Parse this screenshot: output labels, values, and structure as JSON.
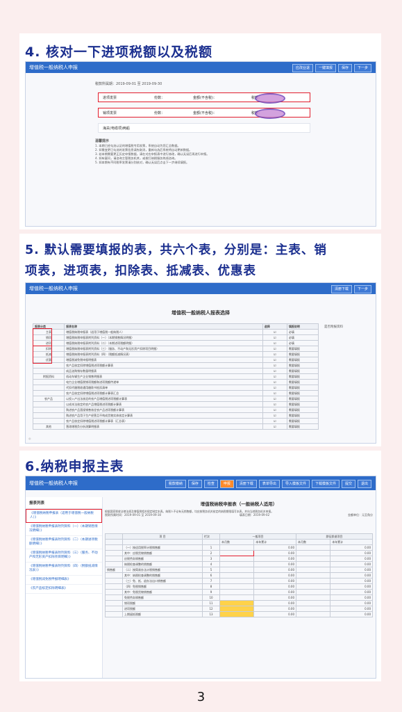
{
  "sections": [
    {
      "heading": "4. 核对一下进项税额以及税额",
      "app_title": "增值税一般纳税人申报",
      "toolbar": [
        "应改业退",
        "一键填报",
        "保存",
        "下一步"
      ],
      "period": "税款所属期：2019-09-01 至 2019-09-30",
      "rows": [
        {
          "label": "进项发票",
          "count_label": "份数：",
          "amount_label": "金额(不含税)：",
          "tax_label": "税额："
        },
        {
          "label": "销项发票",
          "count_label": "份数：",
          "amount_label": "金额(不含税)：",
          "tax_label": "税额："
        }
      ],
      "collapsed_row": "海关(电缆项)两船",
      "notes_title": "温馨提示",
      "notes": [
        "1. 本期已经勾选认证的增值税专用发票，系统自动为您汇总数据。",
        "2. 如需变更已勾选的发票信息请先取消，重新勾选后系统将自动更新数据。",
        "3. 若本期需要更正历史申报数据，请在对应申报表中进行修改，确认无误后再进行申报。",
        "4. 如有疑问，请咨询主管税务机关，或拨打纳税服务热线咨询。",
        "5. 如本期有不同税率发票请分别核对，确认无误后点击下一步继续填报。"
      ]
    },
    {
      "heading_line1": "5. 默认需要填报的表，共六个表，分别是：主表、销",
      "heading_line2": "项表，进项表，扣除表、抵减表、优惠表",
      "app_title": "增值税一般纳税人申报",
      "toolbar": [
        "清册下载",
        "下一步"
      ],
      "table_title": "增值税一般纳税人报表选择",
      "side_note": "是否附报资料",
      "headers": [
        "报表分类",
        "报表名称",
        "选择",
        "填报说明"
      ],
      "groups": [
        {
          "category": "主表",
          "name": "增值税纳税申报表（适用于增值税一般纳税人）",
          "state": "必填"
        },
        {
          "category": "销项",
          "name": "增值税纳税申报表附列资料（一）（本期销售情况明细）",
          "state": "必填"
        },
        {
          "category": "进项",
          "name": "增值税纳税申报表附列资料（二）（本期进项税额明细）",
          "state": "必填"
        },
        {
          "category": "扣除",
          "name": "增值税纳税申报表附列资料（三）（服务、不动产和无形资产扣除项目明细）",
          "state": "需要填报"
        },
        {
          "category": "抵减",
          "name": "增值税纳税申报表附列资料（四）（税额抵减情况表）",
          "state": "需要填报"
        },
        {
          "category": "优惠",
          "name": "增值税减免税申报明细表",
          "state": "需要填报"
        },
        {
          "category": "",
          "name": "农产品核定扣除增值税进项税额计算表",
          "state": "需要填报"
        },
        {
          "category": "",
          "name": "成品油购销存数量明细表",
          "state": "需要填报"
        },
        {
          "category": "附报资料",
          "name": "机动车辆生产企业销售明细表",
          "state": "需要填报"
        },
        {
          "category": "",
          "name": "电力企业增值税销项税额和进项税额传递单",
          "state": "需要填报"
        },
        {
          "category": "",
          "name": "代扣代缴税收通用缴款书抵扣清单",
          "state": "需要填报"
        },
        {
          "category": "",
          "name": "农产品核定扣除增值税进项税额计算表汇总",
          "state": "需要填报"
        },
        {
          "category": "农产品",
          "name": "以投入产出法核定的农产品增值税进项税额计算表",
          "state": "需要填报"
        },
        {
          "category": "",
          "name": "以成本法核定的农产品增值税进项税额计算表",
          "state": "需要填报"
        },
        {
          "category": "",
          "name": "购进农产品直接销售核定农产品进项税额计算表",
          "state": "需要填报"
        },
        {
          "category": "",
          "name": "购进农产品用于生产经营且不构成货物实体核定计算表",
          "state": "需要填报"
        },
        {
          "category": "",
          "name": "农产品核定扣除增值税进项税额计算表（汇总表）",
          "state": "需要填报"
        },
        {
          "category": "其他",
          "name": "营改增税负分析测算明细表",
          "state": "需要填报"
        }
      ]
    },
    {
      "heading": "6.纳税申报主表",
      "app_title": "增值税一般纳税人申报",
      "toolbar": [
        "税款缴纳",
        "保存",
        "检查",
        "申报",
        "清册下载",
        "表单导出",
        "导入模板文件",
        "下载模板文件",
        "提交",
        "退出"
      ],
      "sidebar_title": "报表列表",
      "sidebar_items": [
        "《增值税纳税申报表（适用于增值税一般纳税人）》",
        "《增值税纳税申报表附列资料（一）（本期销售情况明细）》",
        "《增值税纳税申报表附列资料（二）（本期进项税额明细）》",
        "《增值税纳税申报表附列资料（三）（服务、不动产和无形资产扣除项目明细）》",
        "《增值税纳税申报表附列资料（四）（税额抵减情况表）》",
        "《增值税减免税申报明细表》",
        "《农产品核定扣除明细表》"
      ],
      "form_title": "增值税纳税申报表（一般纳税人适用）",
      "form_intro": "根据国家税收法律法规及增值税相关规定制定本表。纳税人不论有无销售额，均应按税务机关核定的纳税期限填写本表，并向当地税务机关申报。",
      "form_period": "税款所属时间：2019-09-01 至 2019-09-30",
      "fill_date": "填表日期：2019-09-02",
      "unit": "金额单位：元至角分",
      "column_headers": [
        "项 目",
        "栏次",
        "一般项目",
        "即征即退项目"
      ],
      "sub_headers": [
        "本月数",
        "本年累计",
        "本月数",
        "本年累计"
      ],
      "group_label": "销售额",
      "items": [
        {
          "name": "（一）按适用税率计税销售额",
          "no": "1",
          "value": "0.00"
        },
        {
          "name": "其中：应税货物销售额",
          "no": "2",
          "value": "0.00"
        },
        {
          "name": "应税劳务销售额",
          "no": "3",
          "value": "0.00"
        },
        {
          "name": "纳税检查调整的销售额",
          "no": "4",
          "value": "0.00"
        },
        {
          "name": "（二）按简易办法计税销售额",
          "no": "5",
          "value": "0.00"
        },
        {
          "name": "其中：纳税检查调整的销售额",
          "no": "6",
          "value": "0.00"
        },
        {
          "name": "（三）免、抵、退办法出口销售额",
          "no": "7",
          "value": "0.00"
        },
        {
          "name": "（四）免税销售额",
          "no": "8",
          "value": "0.00"
        },
        {
          "name": "其中：免税货物销售额",
          "no": "9",
          "value": "0.00"
        },
        {
          "name": "免税劳务销售额",
          "no": "10",
          "value": "0.00"
        },
        {
          "name": "销项税额",
          "no": "11",
          "value": "0.00"
        },
        {
          "name": "进项税额",
          "no": "12",
          "value": "0.00"
        },
        {
          "name": "上期留抵税额",
          "no": "13",
          "value": "0.00"
        }
      ]
    }
  ],
  "page_number": "3"
}
